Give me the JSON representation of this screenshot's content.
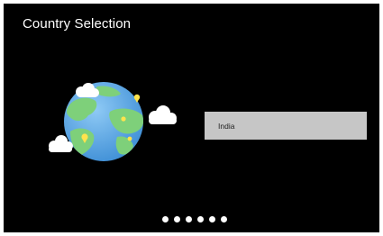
{
  "screen": {
    "title": "Country Selection",
    "background": "#000000"
  },
  "illustration": {
    "icon": "globe-with-clouds-icon",
    "colors": {
      "ocean": "#5aa7e6",
      "land": "#7ed07a",
      "cloud": "#ffffff",
      "pin": "#ffe34d"
    }
  },
  "country_list": {
    "selected": "India",
    "selected_background": "#c6c6c6"
  },
  "pager": {
    "page_count": 6,
    "dot_color": "#ffffff"
  }
}
